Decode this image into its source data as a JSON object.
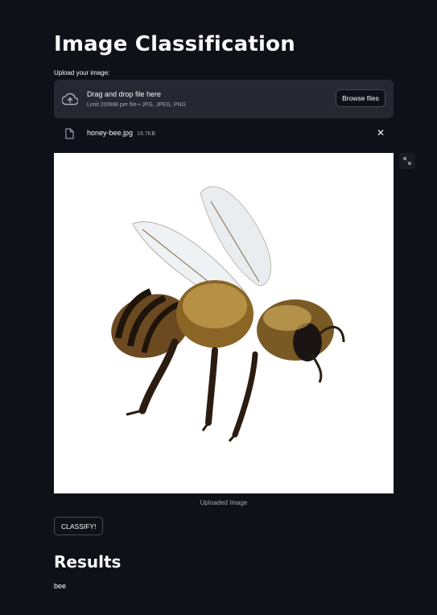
{
  "page": {
    "title": "Image Classification",
    "upload_label": "Upload your image:",
    "dropzone": {
      "main_text": "Drag and drop file here",
      "sub_text": "Limit 200MB per file • JPG, JPEG, PNG",
      "browse_label": "Browse files",
      "icon": "cloud-upload-icon"
    },
    "file": {
      "name": "honey-bee.jpg",
      "size": "18.7KB",
      "icon": "file-icon",
      "close_glyph": "✕"
    },
    "image_caption": "Uploaded Image",
    "classify_label": "CLASSIFY!",
    "results_heading": "Results",
    "result_value": "bee"
  },
  "colors": {
    "background": "#0e1117",
    "dropzone": "#262730",
    "text": "#fafafa",
    "muted_text": "#a3a8b8",
    "border": "#4a4c57"
  }
}
